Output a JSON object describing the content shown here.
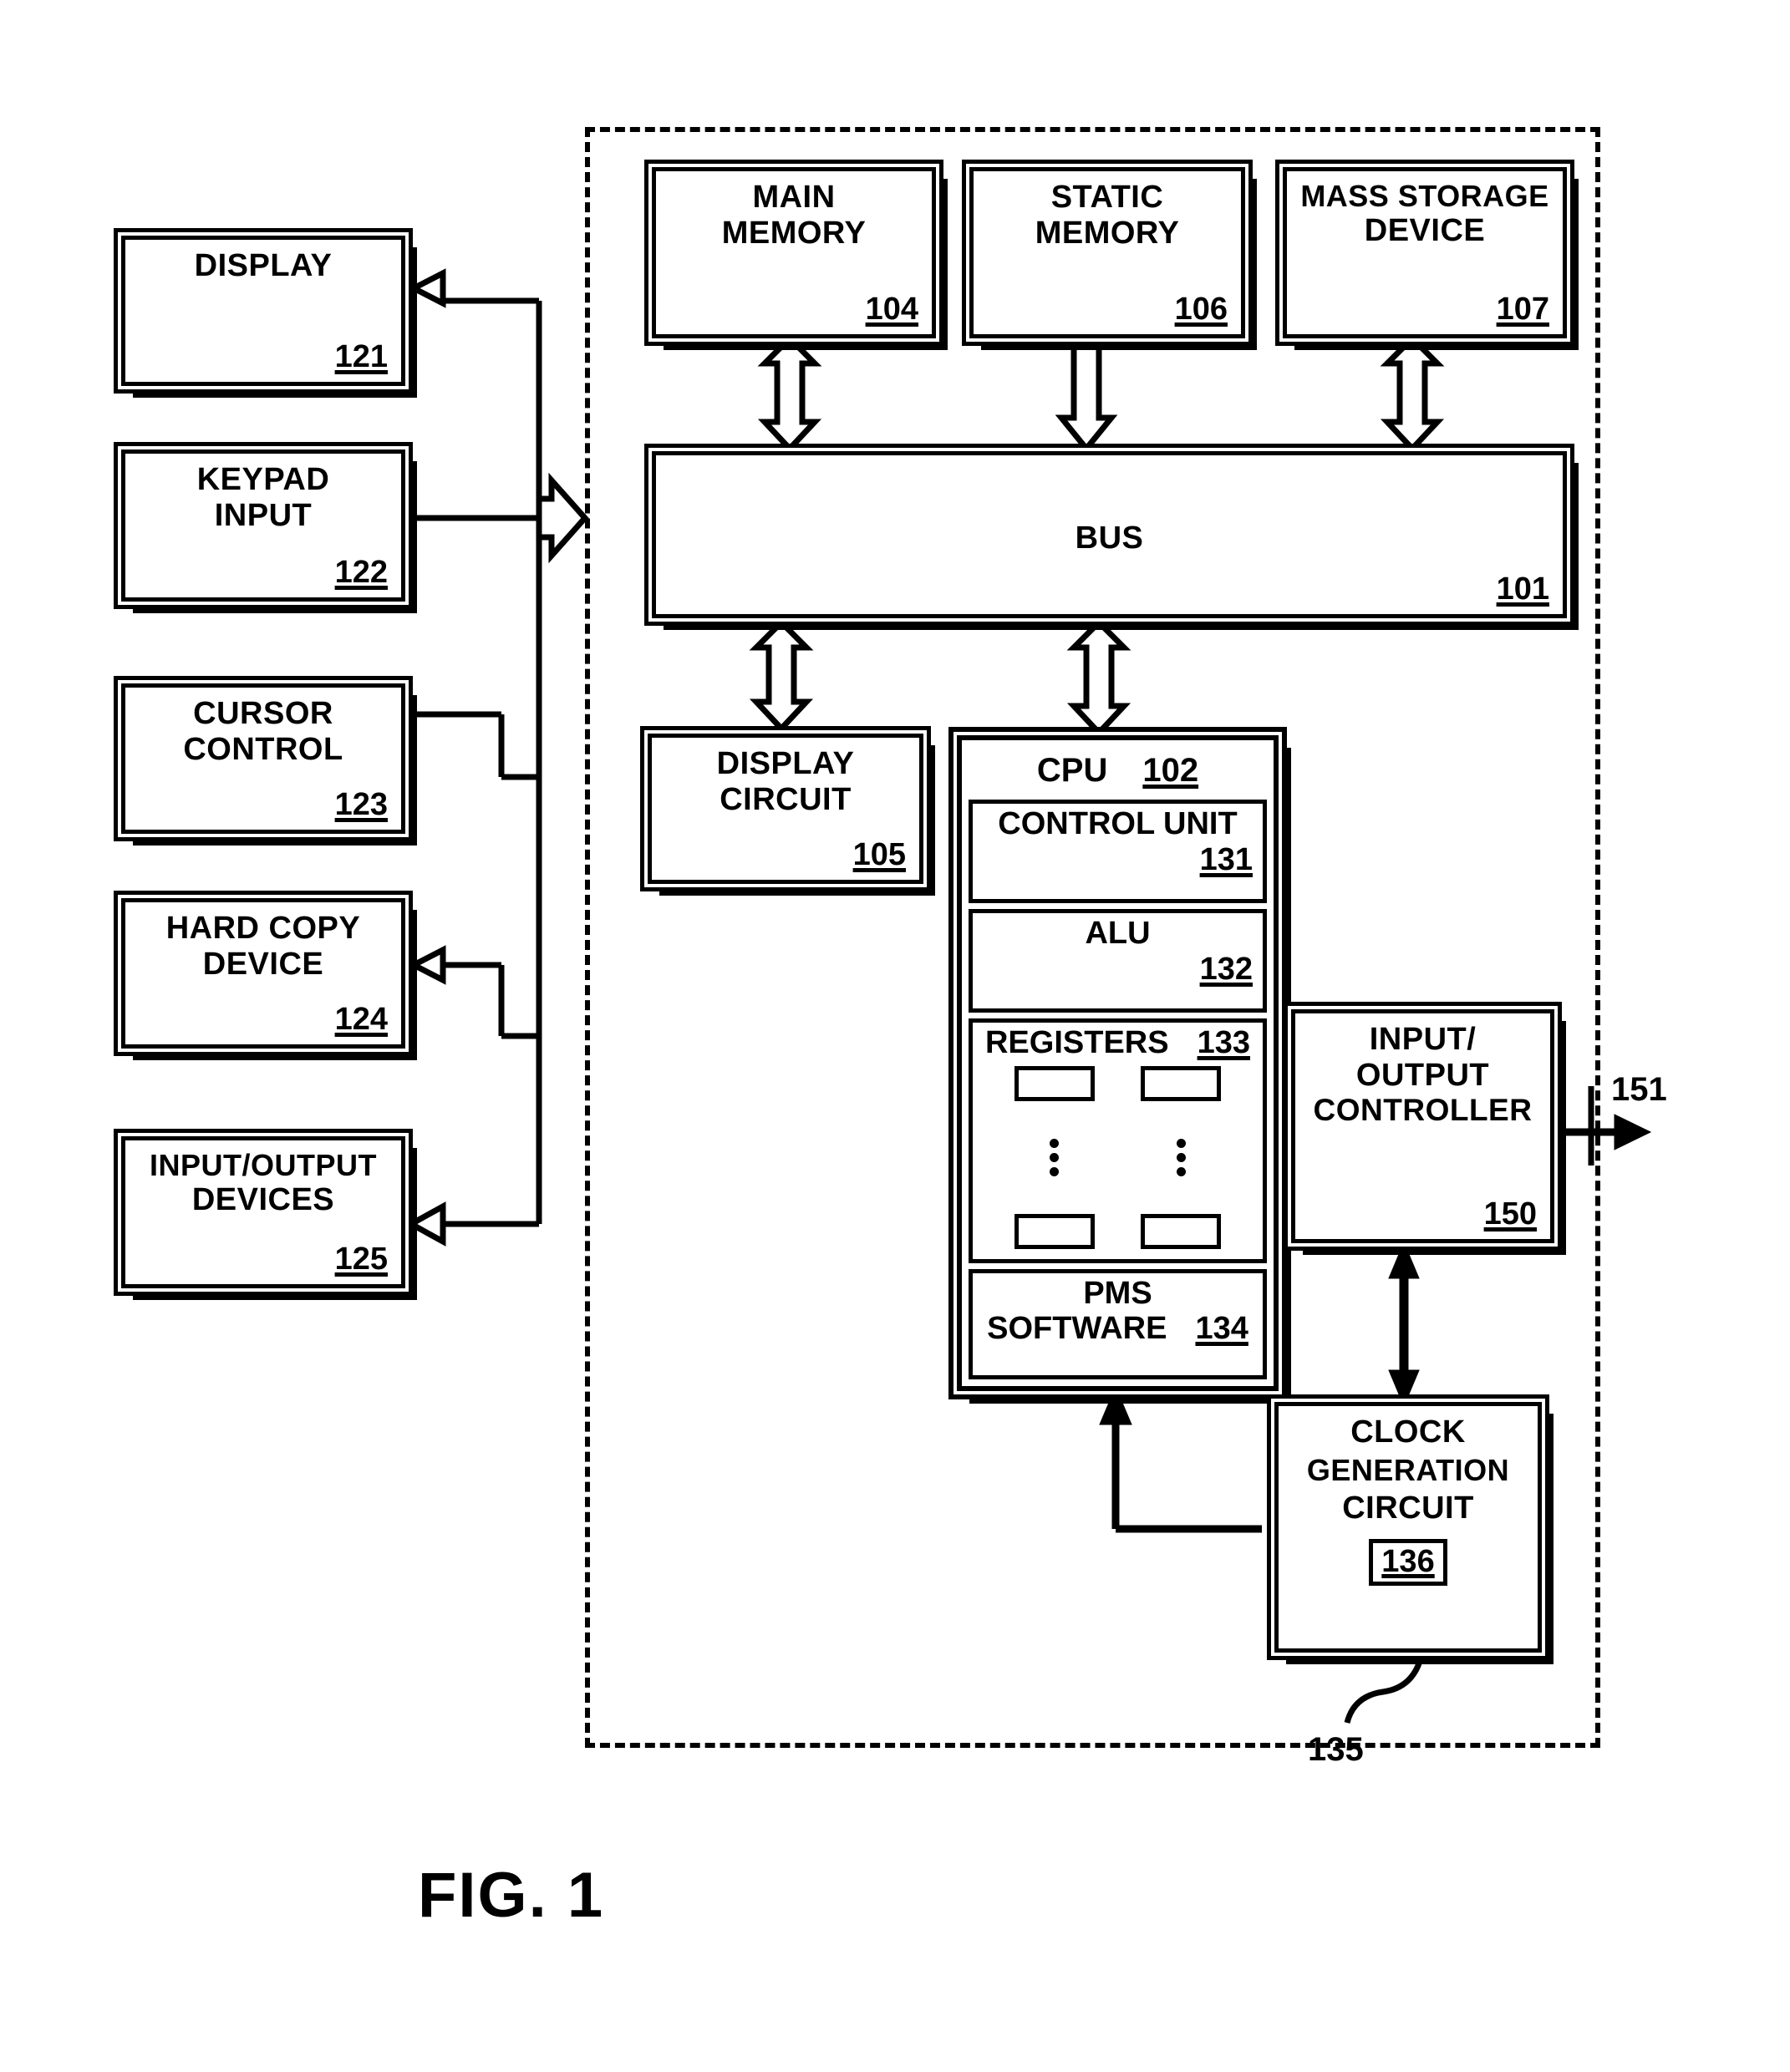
{
  "figure": {
    "caption": "FIG. 1",
    "enclosure_name": "computer-system-boundary"
  },
  "peripherals": [
    {
      "label": "DISPLAY",
      "ref": "121"
    },
    {
      "label_line1": "KEYPAD",
      "label_line2": "INPUT",
      "ref": "122"
    },
    {
      "label_line1": "CURSOR",
      "label_line2": "CONTROL",
      "ref": "123"
    },
    {
      "label_line1": "HARD COPY",
      "label_line2": "DEVICE",
      "ref": "124"
    },
    {
      "label_line1": "INPUT/OUTPUT",
      "label_line2": "DEVICES",
      "ref": "125"
    }
  ],
  "memories": [
    {
      "label_line1": "MAIN",
      "label_line2": "MEMORY",
      "ref": "104"
    },
    {
      "label_line1": "STATIC",
      "label_line2": "MEMORY",
      "ref": "106"
    },
    {
      "label_line1": "MASS STORAGE",
      "label_line2": "DEVICE",
      "ref": "107"
    }
  ],
  "bus": {
    "label": "BUS",
    "ref": "101"
  },
  "display_circuit": {
    "label_line1": "DISPLAY",
    "label_line2": "CIRCUIT",
    "ref": "105"
  },
  "cpu": {
    "title": "CPU",
    "ref": "102",
    "control_unit": {
      "label": "CONTROL UNIT",
      "ref": "131"
    },
    "alu": {
      "label": "ALU",
      "ref": "132"
    },
    "registers": {
      "label": "REGISTERS",
      "ref": "133"
    },
    "pms": {
      "label_line1": "PMS",
      "label_line2": "SOFTWARE",
      "ref": "134"
    }
  },
  "io_controller": {
    "label_line1": "INPUT/",
    "label_line2": "OUTPUT",
    "label_line3": "CONTROLLER",
    "ref": "150"
  },
  "clock": {
    "label_line1": "CLOCK",
    "label_line2": "GENERATION",
    "label_line3": "CIRCUIT",
    "ref_boxed": "136",
    "ref_callout": "135"
  },
  "external_io": {
    "ref": "151"
  },
  "colors": {
    "ink": "#000000",
    "paper": "#ffffff"
  }
}
